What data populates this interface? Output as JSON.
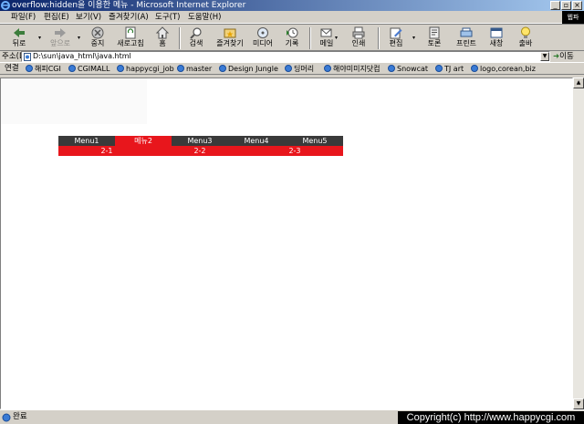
{
  "window": {
    "title": "overflow:hidden을 이용한 메뉴 - Microsoft Internet Explorer",
    "brand_badge": "웹파"
  },
  "menubar": {
    "items": [
      "파일(F)",
      "편집(E)",
      "보기(V)",
      "즐겨찾기(A)",
      "도구(T)",
      "도움말(H)"
    ]
  },
  "toolbar": {
    "back": "뒤로",
    "forward": "앞으로",
    "stop": "중지",
    "refresh": "새로고침",
    "home": "홈",
    "search": "검색",
    "favorites": "즐겨찾기",
    "media": "미디어",
    "history": "기록",
    "mail": "메일",
    "print": "인쇄",
    "edit": "편집",
    "discuss": "토론",
    "printer": "프린트",
    "window": "새창",
    "light": "출바"
  },
  "address": {
    "label": "주소(D)",
    "value": "D:\\sun\\java_html\\java.html",
    "go_label": "이동"
  },
  "links": {
    "label": "연결",
    "items": [
      "해피CGI",
      "CGIMALL",
      "happycgi_job",
      "master",
      "Design Jungle",
      "딩머리",
      "해야미미지닷컴",
      "Snowcat",
      "TJ art",
      "logo,corean,biz"
    ]
  },
  "page_menu": {
    "top_items": [
      "Menu1",
      "메뉴2",
      "Menu3",
      "Menu4",
      "Menu5"
    ],
    "active_index": 1,
    "sub_items": [
      "2-1",
      "2-2",
      "2-3"
    ],
    "colors": {
      "bar": "#3a3a3a",
      "active": "#e8161c"
    }
  },
  "status": {
    "text": "완료",
    "copyright": "Copyright(c) http://www.happycgi.com"
  }
}
